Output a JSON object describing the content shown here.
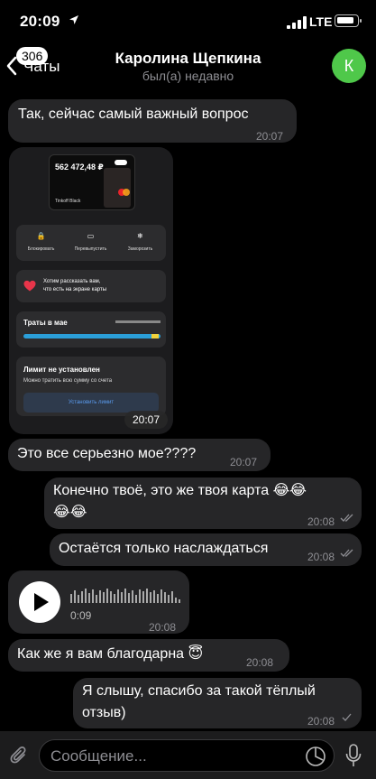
{
  "status_bar": {
    "time": "20:09",
    "network": "LTE"
  },
  "header": {
    "back_badge": "306",
    "back_label": "Чаты",
    "name": "Каролина Щепкина",
    "status": "был(а) недавно",
    "avatar_letter": "К",
    "avatar_color": "#4fc84a"
  },
  "messages": [
    {
      "text": "Так, сейчас самый важный вопрос",
      "time": "20:07"
    },
    {
      "type": "image",
      "time": "20:07",
      "card": {
        "balance": "562 472,48 ₽",
        "name": "Tinkoff Black"
      },
      "actions": [
        "Блокировать",
        "Перевыпустить",
        "Заморозить"
      ],
      "info_line1": "Хотим рассказать вам,",
      "info_line2": "что есть на экране карты",
      "spending_title": "Траты в мае",
      "limit_title": "Лимит не установлен",
      "limit_sub": "Можно тратить всю сумму со счета",
      "limit_button": "Установить лимит"
    },
    {
      "text": "Это все серьезно мое????",
      "time": "20:07"
    },
    {
      "text_line1": "Конечно твоё, это же твоя карта 😂😂",
      "text_line2": "😂😂",
      "time": "20:08"
    },
    {
      "text": "Остаётся только наслаждаться",
      "time": "20:08"
    },
    {
      "type": "voice",
      "duration": "0:09",
      "time": "20:08"
    },
    {
      "text": "Как же я вам благодарна 😇",
      "time": "20:08"
    },
    {
      "text_line1": "Я слышу, спасибо за такой тёплый",
      "text_line2": "отзыв)",
      "time": "20:08"
    }
  ],
  "input": {
    "placeholder": "Сообщение..."
  },
  "colors": {
    "bubble": "#262628",
    "background": "#000000",
    "accent": "#5a9bef"
  }
}
